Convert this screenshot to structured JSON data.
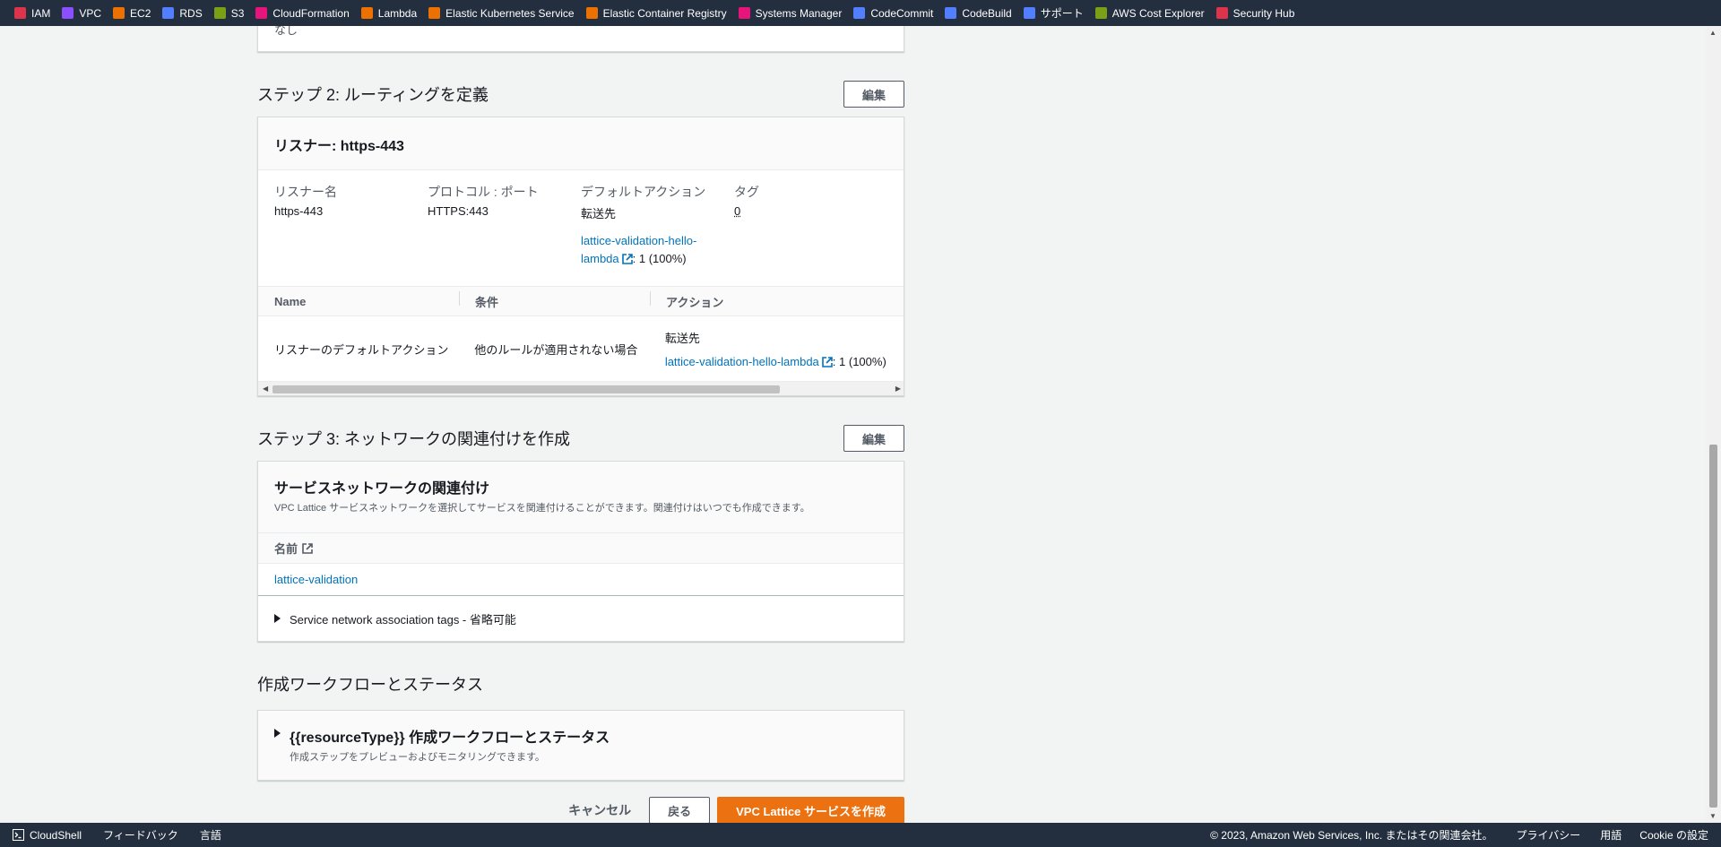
{
  "favorites": [
    {
      "label": "IAM",
      "color": "#dd344c"
    },
    {
      "label": "VPC",
      "color": "#8c4fff"
    },
    {
      "label": "EC2",
      "color": "#ed7100"
    },
    {
      "label": "RDS",
      "color": "#527fff"
    },
    {
      "label": "S3",
      "color": "#7aa116"
    },
    {
      "label": "CloudFormation",
      "color": "#e7157b"
    },
    {
      "label": "Lambda",
      "color": "#ed7100"
    },
    {
      "label": "Elastic Kubernetes Service",
      "color": "#ed7100"
    },
    {
      "label": "Elastic Container Registry",
      "color": "#ed7100"
    },
    {
      "label": "Systems Manager",
      "color": "#e7157b"
    },
    {
      "label": "CodeCommit",
      "color": "#527fff"
    },
    {
      "label": "CodeBuild",
      "color": "#527fff"
    },
    {
      "label": "サポート",
      "color": "#527fff"
    },
    {
      "label": "AWS Cost Explorer",
      "color": "#7aa116"
    },
    {
      "label": "Security Hub",
      "color": "#dd344c"
    }
  ],
  "top_card": {
    "text": "なし"
  },
  "step2": {
    "title": "ステップ 2: ルーティングを定義",
    "edit_label": "編集",
    "listener_title": "リスナー: https-443",
    "fields": {
      "name_label": "リスナー名",
      "name_value": "https-443",
      "protocol_label": "プロトコル : ポート",
      "protocol_value": "HTTPS:443",
      "default_action_label": "デフォルトアクション",
      "default_action_prefix": "転送先",
      "default_action_link_line1": "lattice-validation-hello-",
      "default_action_link_line2": "lambda",
      "default_action_suffix": ": 1 (100%)",
      "tags_label": "タグ",
      "tags_value": "0"
    },
    "table": {
      "headers": [
        "Name",
        "条件",
        "アクション"
      ],
      "row": {
        "name": "リスナーのデフォルトアクション",
        "condition": "他のルールが適用されない場合",
        "action_prefix": "転送先",
        "action_link": "lattice-validation-hello-lambda",
        "action_suffix": ": 1 (100%)"
      }
    }
  },
  "step3": {
    "title": "ステップ 3: ネットワークの関連付けを作成",
    "edit_label": "編集",
    "card_title": "サービスネットワークの関連付け",
    "card_desc": "VPC Lattice サービスネットワークを選択してサービスを関連付けることができます。関連付けはいつでも作成できます。",
    "column_header": "名前",
    "network_link": "lattice-validation",
    "tags_expander": "Service network association tags - 省略可能"
  },
  "workflow": {
    "title": "作成ワークフローとステータス",
    "expander_title": "{{resourceType}} 作成ワークフローとステータス",
    "expander_desc": "作成ステップをプレビューおよびモニタリングできます。"
  },
  "actions": {
    "cancel": "キャンセル",
    "back": "戻る",
    "create": "VPC Lattice サービスを作成"
  },
  "bottombar": {
    "cloudshell": "CloudShell",
    "feedback": "フィードバック",
    "language": "言語",
    "copyright": "© 2023, Amazon Web Services, Inc. またはその関連会社。",
    "privacy": "プライバシー",
    "terms": "用語",
    "cookie": "Cookie の設定"
  }
}
